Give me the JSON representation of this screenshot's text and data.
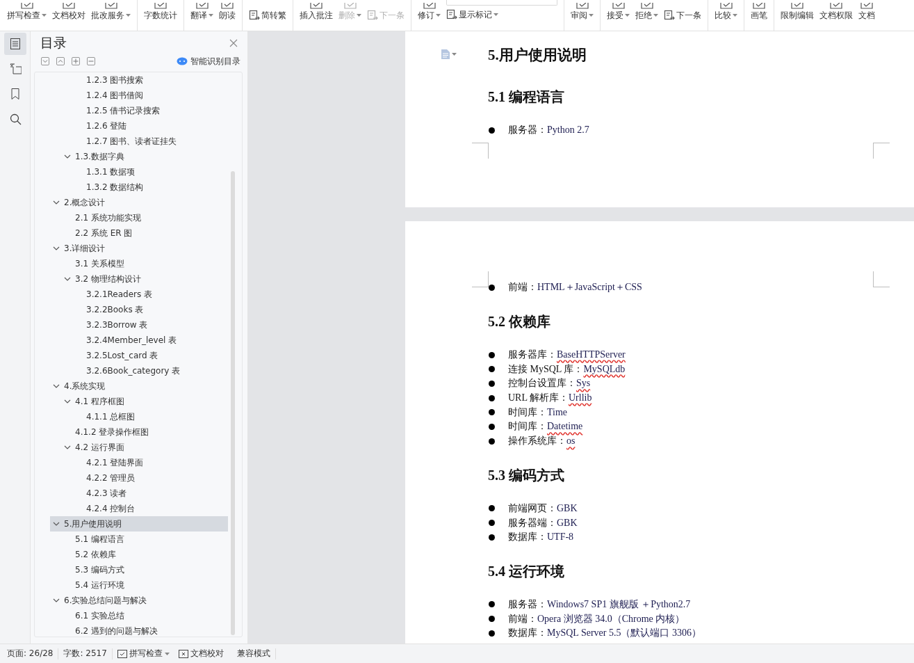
{
  "toolbar": {
    "items": [
      {
        "label": "拼写检查",
        "kind": "large",
        "caret": true,
        "disabled": false,
        "group_start": false
      },
      {
        "label": "文档校对",
        "kind": "large",
        "caret": false,
        "disabled": false,
        "group_start": false
      },
      {
        "label": "批改服务",
        "kind": "large",
        "caret": true,
        "disabled": false,
        "group_start": false
      },
      {
        "label": "字数统计",
        "kind": "large",
        "caret": false,
        "disabled": false,
        "group_start": true
      },
      {
        "label": "翻译",
        "kind": "large",
        "caret": true,
        "disabled": false,
        "group_start": true
      },
      {
        "label": "朗读",
        "kind": "large",
        "caret": false,
        "disabled": false,
        "group_start": false
      },
      {
        "label": "简转繁",
        "kind": "small",
        "caret": false,
        "disabled": false,
        "group_start": true
      },
      {
        "label": "插入批注",
        "kind": "large",
        "caret": false,
        "disabled": false,
        "group_start": true
      },
      {
        "label": "删除",
        "kind": "large",
        "caret": true,
        "disabled": true,
        "group_start": false
      },
      {
        "label": "下一条",
        "kind": "small",
        "caret": false,
        "disabled": true,
        "group_start": false
      },
      {
        "label": "修订",
        "kind": "large",
        "caret": true,
        "disabled": false,
        "group_start": true
      },
      {
        "label": "显示标记",
        "kind": "combo",
        "caret": true,
        "disabled": false,
        "group_start": false
      },
      {
        "label": "审阅",
        "kind": "large",
        "caret": true,
        "disabled": false,
        "group_start": true
      },
      {
        "label": "接受",
        "kind": "large",
        "caret": true,
        "disabled": false,
        "group_start": true
      },
      {
        "label": "拒绝",
        "kind": "large",
        "caret": true,
        "disabled": false,
        "group_start": false
      },
      {
        "label": "下一条",
        "kind": "small",
        "caret": false,
        "disabled": false,
        "group_start": false
      },
      {
        "label": "比较",
        "kind": "large",
        "caret": true,
        "disabled": false,
        "group_start": true
      },
      {
        "label": "画笔",
        "kind": "large",
        "caret": false,
        "disabled": false,
        "group_start": true
      },
      {
        "label": "限制编辑",
        "kind": "large",
        "caret": false,
        "disabled": false,
        "group_start": true
      },
      {
        "label": "文档权限",
        "kind": "large",
        "caret": false,
        "disabled": false,
        "group_start": false
      },
      {
        "label": "文档",
        "kind": "large",
        "caret": false,
        "disabled": false,
        "group_start": false
      }
    ]
  },
  "rail": {
    "items": [
      {
        "selected": true
      },
      {
        "selected": false
      },
      {
        "selected": false
      },
      {
        "selected": false
      }
    ]
  },
  "toc": {
    "title": "目录",
    "smart_button": "智能识别目录",
    "items": [
      {
        "children": [
          {
            "children": [
              {
                "label": "1.2.3 图书搜索",
                "selected": false
              },
              {
                "label": "1.2.4 图书借阅",
                "selected": false
              },
              {
                "label": "1.2.5 借书记录搜索",
                "selected": false
              },
              {
                "label": "1.2.6 登陆",
                "selected": false
              },
              {
                "label": "1.2.7 图书、读者证挂失",
                "selected": false
              }
            ]
          },
          {
            "label": "1.3.数据字典",
            "selected": false,
            "expanded": true,
            "children": [
              {
                "label": "1.3.1 数据项",
                "selected": false
              },
              {
                "label": "1.3.2 数据结构",
                "selected": false
              }
            ]
          }
        ]
      },
      {
        "label": "2.概念设计",
        "selected": false,
        "expanded": true,
        "children": [
          {
            "label": "2.1 系统功能实现",
            "selected": false
          },
          {
            "label": "2.2 系统 ER 图",
            "selected": false
          }
        ]
      },
      {
        "label": "3.详细设计",
        "selected": false,
        "expanded": true,
        "children": [
          {
            "label": "3.1 关系模型",
            "selected": false
          },
          {
            "label": "3.2 物理结构设计",
            "selected": false,
            "expanded": true,
            "children": [
              {
                "label": "3.2.1Readers 表",
                "selected": false
              },
              {
                "label": "3.2.2Books 表",
                "selected": false
              },
              {
                "label": "3.2.3Borrow 表",
                "selected": false
              },
              {
                "label": "3.2.4Member_level 表",
                "selected": false
              },
              {
                "label": "3.2.5Lost_card 表",
                "selected": false
              },
              {
                "label": "3.2.6Book_category 表",
                "selected": false
              }
            ]
          }
        ]
      },
      {
        "label": "4.系统实现",
        "selected": false,
        "expanded": true,
        "children": [
          {
            "label": "4.1 程序框图",
            "selected": false,
            "expanded": true,
            "children": [
              {
                "label": "4.1.1 总框图",
                "selected": false
              }
            ]
          },
          {
            "label": "4.1.2 登录操作框图",
            "selected": false
          },
          {
            "label": "4.2 运行界面",
            "selected": false,
            "expanded": true,
            "children": [
              {
                "label": "4.2.1 登陆界面",
                "selected": false
              },
              {
                "label": "4.2.2 管理员",
                "selected": false
              },
              {
                "label": "4.2.3 读者",
                "selected": false
              },
              {
                "label": "4.2.4 控制台",
                "selected": false
              }
            ]
          }
        ]
      },
      {
        "label": "5.用户使用说明",
        "selected": true,
        "expanded": true,
        "children": [
          {
            "label": "5.1 编程语言",
            "selected": false
          },
          {
            "label": "5.2 依赖库",
            "selected": false
          },
          {
            "label": "5.3 编码方式",
            "selected": false
          },
          {
            "label": "5.4 运行环境",
            "selected": false
          }
        ]
      },
      {
        "label": "6.实验总结问题与解决",
        "selected": false,
        "expanded": true,
        "children": [
          {
            "label": "6.1 实验总结",
            "selected": false
          },
          {
            "label": "6.2 遇到的问题与解决",
            "selected": false
          }
        ]
      }
    ]
  },
  "document": {
    "pages": [
      {
        "blocks": [
          {
            "kind": "title",
            "text": "5.用户使用说明"
          },
          {
            "kind": "heading",
            "text": "5.1 编程语言"
          },
          {
            "kind": "bullet",
            "label": "服务器：",
            "value": "Python 2.7",
            "flagged": false
          }
        ]
      },
      {
        "blocks": [
          {
            "kind": "bullet",
            "label": "前端：",
            "value": "HTML＋JavaScript＋CSS",
            "flagged": false
          },
          {
            "kind": "heading",
            "text": "5.2 依赖库"
          },
          {
            "kind": "bullet",
            "label": "服务器库：",
            "value": "BaseHTTPServer",
            "flagged": true
          },
          {
            "kind": "bullet",
            "label": "连接 MySQL 库：",
            "value": "MySQLdb",
            "flagged": true
          },
          {
            "kind": "bullet",
            "label": "控制台设置库：",
            "value": "Sys",
            "flagged": true
          },
          {
            "kind": "bullet",
            "label": "URL 解析库：",
            "value": "Urllib",
            "flagged": true
          },
          {
            "kind": "bullet",
            "label": "时间库：",
            "value": "Time",
            "flagged": false
          },
          {
            "kind": "bullet",
            "label": "时间库：",
            "value": "Datetime",
            "flagged": true
          },
          {
            "kind": "bullet",
            "label": "操作系统库：",
            "value": "os",
            "flagged": true
          },
          {
            "kind": "heading",
            "text": "5.3 编码方式"
          },
          {
            "kind": "bullet",
            "label": "前端网页：",
            "value": "GBK",
            "flagged": false
          },
          {
            "kind": "bullet",
            "label": "服务器端：",
            "value": "GBK",
            "flagged": false
          },
          {
            "kind": "bullet",
            "label": "数据库：",
            "value": "UTF-8",
            "flagged": false
          },
          {
            "kind": "heading",
            "text": "5.4 运行环境"
          },
          {
            "kind": "bullet",
            "label": "服务器：",
            "value": "Windows7 SP1 旗舰版 ＋Python2.7",
            "flagged": false
          },
          {
            "kind": "bullet",
            "label": "前端：",
            "value": "Opera 浏览器 34.0（Chrome 内核）",
            "flagged": false
          },
          {
            "kind": "bullet",
            "label": "数据库：",
            "value": "MySQL Server 5.5（默认端口 3306）",
            "flagged": false
          }
        ]
      }
    ]
  },
  "status_bar": {
    "page": "页面: 26/28",
    "words": "字数: 2517",
    "spell_check": "拼写检查",
    "proofread": "文档校对",
    "mode": "兼容模式"
  }
}
